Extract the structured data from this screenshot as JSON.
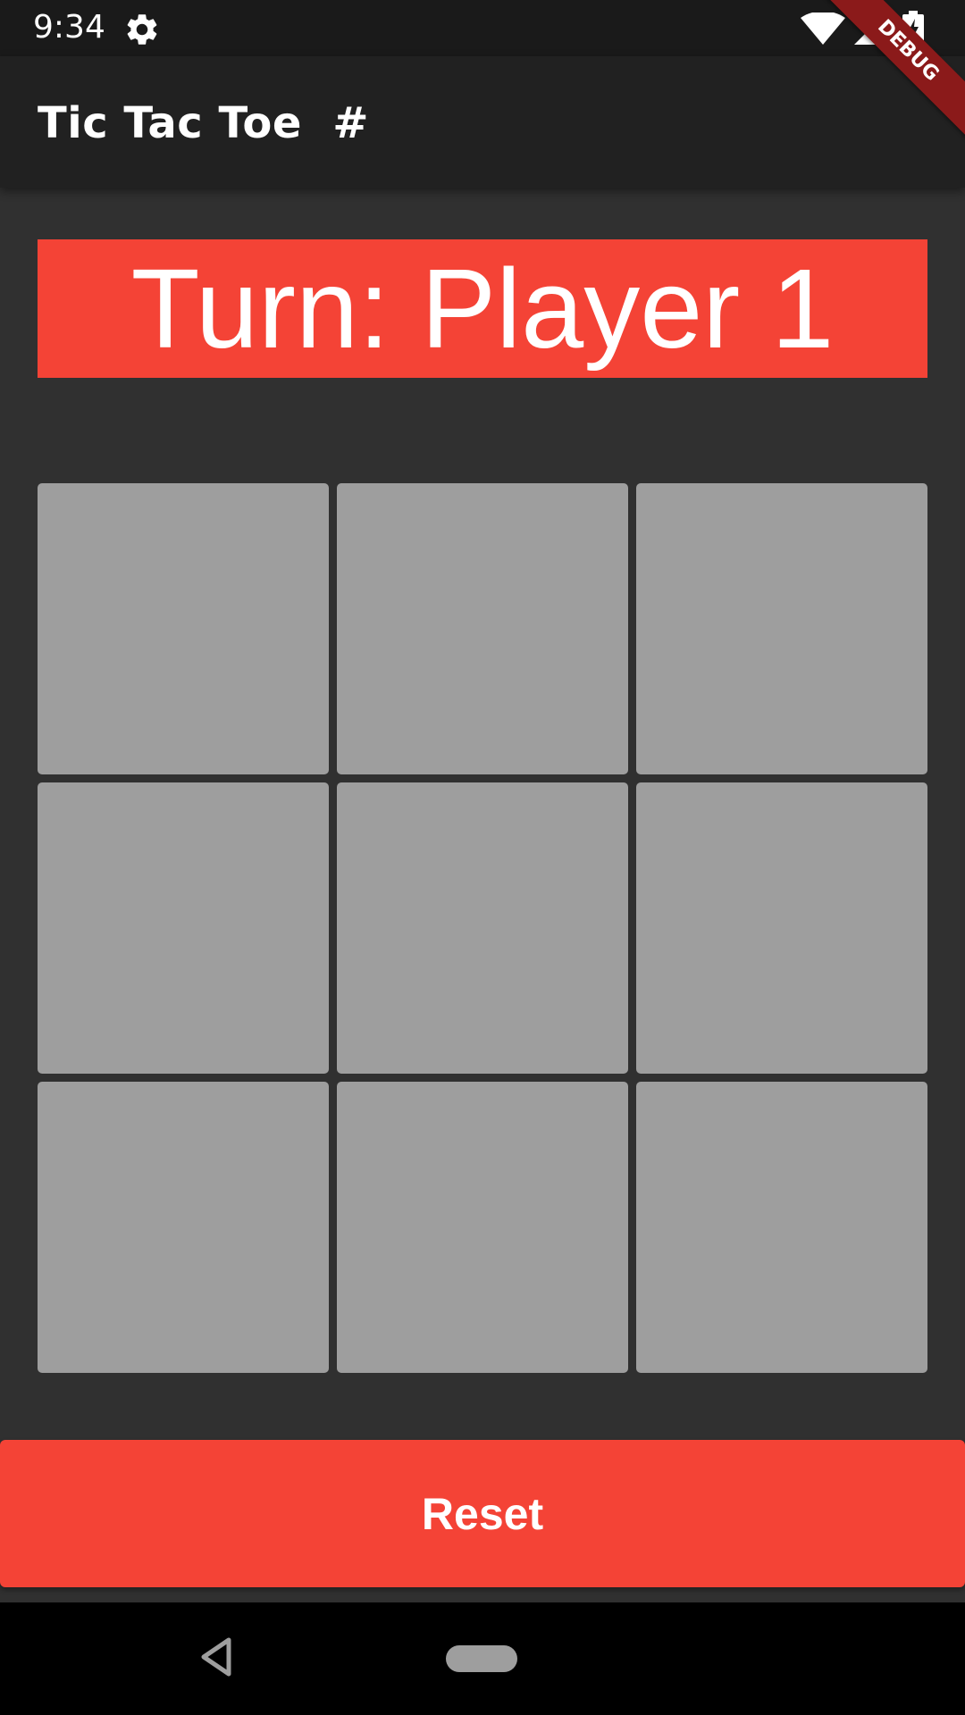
{
  "status_bar": {
    "time": "9:34",
    "icons": [
      "gear-icon",
      "wifi-icon",
      "signal-icon",
      "battery-charging-icon"
    ]
  },
  "app_bar": {
    "title": "Tic Tac Toe  #"
  },
  "debug_banner": {
    "label": "DEBUG"
  },
  "game": {
    "turn_text": "Turn: Player 1",
    "board": [
      "",
      "",
      "",
      "",
      "",
      "",
      "",
      "",
      ""
    ]
  },
  "reset_button": {
    "label": "Reset"
  },
  "navigation": {
    "icons": [
      "back-icon",
      "home-pill-icon"
    ]
  },
  "colors": {
    "background": "#303030",
    "app_bar": "#212121",
    "accent": "#f44336",
    "cell": "#9e9e9e",
    "debug_banner": "#8b1a1a"
  }
}
